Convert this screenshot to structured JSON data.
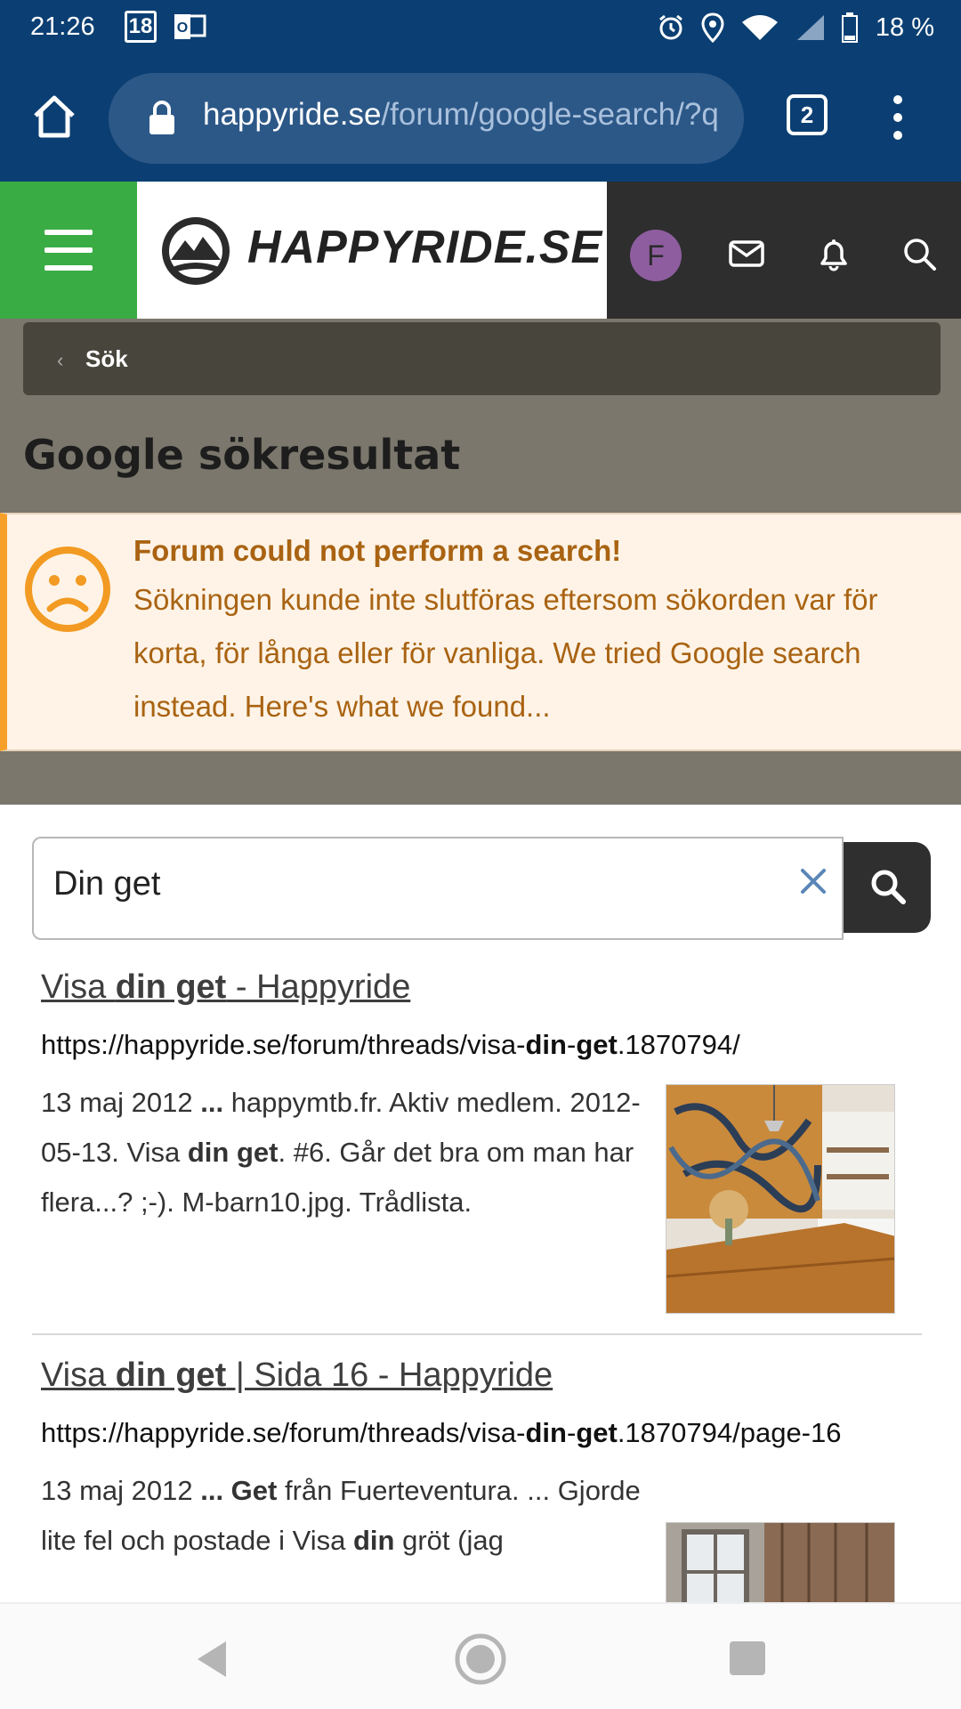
{
  "status_bar": {
    "time": "21:26",
    "calendar_day": "18",
    "battery": "18 %"
  },
  "browser": {
    "url_domain": "happyride.se",
    "url_path": "/forum/google-search/?q",
    "tab_count": "2"
  },
  "site_header": {
    "logo_text": "HAPPYRIDE.SE",
    "avatar_letter": "F",
    "brand_color": "#3aac44"
  },
  "breadcrumb": {
    "label": "Sök"
  },
  "page": {
    "title": "Google sökresultat"
  },
  "alert": {
    "title": "Forum could not perform a search!",
    "body": "Sökningen kunde inte slutföras eftersom sökorden var för korta, för långa eller för vanliga. We tried Google search instead. Here's what we found..."
  },
  "search": {
    "value": "Din get"
  },
  "results": [
    {
      "title_pre": "Visa ",
      "title_bold": "din get",
      "title_post": " - Happyride",
      "url_pre": "https://happyride.se/forum/threads/visa-",
      "url_bold1": "din",
      "url_mid": "-",
      "url_bold2": "get",
      "url_post": ".1870794/",
      "snippet_1": "13 maj 2012 ",
      "snippet_1b": "...",
      "snippet_2": " happymtb.fr. Aktiv medlem. 2012-05-13. Visa ",
      "snippet_2b": "din get",
      "snippet_3": ". #6. Går det bra om man har flera...? ;-). M-barn10.jpg. Trådlista."
    },
    {
      "title_pre": "Visa ",
      "title_bold": "din get",
      "title_post": " | Sida 16 - Happyride",
      "url_pre": "https://happyride.se/forum/threads/visa-",
      "url_bold1": "din",
      "url_mid": "-",
      "url_bold2": "get",
      "url_post": ".1870794/page-16",
      "snippet_1": "13 maj 2012 ",
      "snippet_1b": "... Get",
      "snippet_2": " från Fuerteventura. ... Gjorde lite fel och postade i Visa ",
      "snippet_2b": "din",
      "snippet_3": " gröt (jag"
    }
  ]
}
